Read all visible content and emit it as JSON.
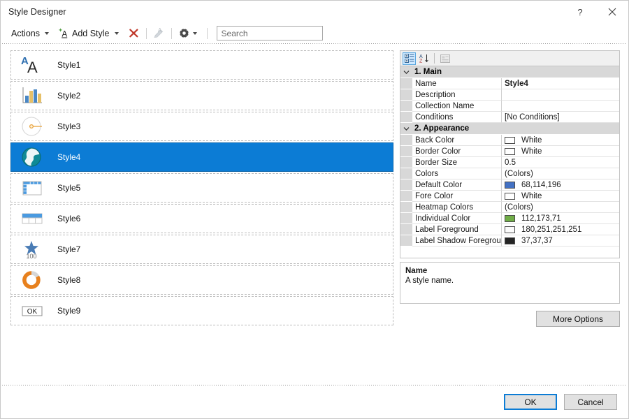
{
  "window": {
    "title": "Style Designer",
    "help_label": "?",
    "close_label": "Close"
  },
  "toolbar": {
    "actions_label": "Actions",
    "add_style_label": "Add Style",
    "delete_icon": "delete-style-icon",
    "edit_icon": "edit-style-icon",
    "settings_icon": "gear-icon",
    "search": {
      "placeholder": "Search",
      "value": ""
    }
  },
  "style_list": {
    "items": [
      {
        "label": "Style1",
        "icon": "text-style-icon",
        "selected": false
      },
      {
        "label": "Style2",
        "icon": "bar-chart-icon",
        "selected": false
      },
      {
        "label": "Style3",
        "icon": "gauge-icon",
        "selected": false
      },
      {
        "label": "Style4",
        "icon": "globe-map-icon",
        "selected": true
      },
      {
        "label": "Style5",
        "icon": "table-grid-icon",
        "selected": false
      },
      {
        "label": "Style6",
        "icon": "table-header-icon",
        "selected": false
      },
      {
        "label": "Style7",
        "icon": "kpi-star-icon",
        "selected": false,
        "badge": "100"
      },
      {
        "label": "Style8",
        "icon": "donut-chart-icon",
        "selected": false
      },
      {
        "label": "Style9",
        "icon": "button-ok-icon",
        "selected": false,
        "badge": "OK"
      }
    ]
  },
  "property_grid": {
    "toolbar": {
      "categorized_icon": "categorized-view-icon",
      "alphabetical_icon": "alphabetical-sort-icon",
      "property_pages_icon": "property-pages-icon"
    },
    "categories": [
      {
        "label": "1. Main",
        "expanded": true,
        "rows": [
          {
            "name": "Name",
            "value": "Style4",
            "bold": true
          },
          {
            "name": "Description",
            "value": ""
          },
          {
            "name": "Collection Name",
            "value": ""
          },
          {
            "name": "Conditions",
            "value": "[No Conditions]"
          }
        ]
      },
      {
        "label": "2. Appearance",
        "expanded": true,
        "rows": [
          {
            "name": "Back Color",
            "value": "White",
            "swatch": "#ffffff"
          },
          {
            "name": "Border Color",
            "value": "White",
            "swatch": "#ffffff"
          },
          {
            "name": "Border Size",
            "value": "0.5"
          },
          {
            "name": "Colors",
            "value": "(Colors)"
          },
          {
            "name": "Default Color",
            "value": "68,114,196",
            "swatch": "#4472c4"
          },
          {
            "name": "Fore Color",
            "value": "White",
            "swatch": "#ffffff"
          },
          {
            "name": "Heatmap Colors",
            "value": "(Colors)"
          },
          {
            "name": "Individual Color",
            "value": "112,173,71",
            "swatch": "#70ad47"
          },
          {
            "name": "Label Foreground",
            "value": "180,251,251,251",
            "swatch": "#fbfbfb"
          },
          {
            "name": "Label Shadow Foregroun",
            "value": "37,37,37",
            "swatch": "#252525"
          }
        ]
      }
    ],
    "description": {
      "title": "Name",
      "text": "A style name."
    },
    "more_options_label": "More Options"
  },
  "footer": {
    "ok_label": "OK",
    "cancel_label": "Cancel"
  },
  "colors": {
    "selection_blue": "#0c7cd5",
    "accent_blue": "#4472c4",
    "delete_red": "#c0392b",
    "add_green": "#4e9a3e",
    "orange": "#e8861e",
    "category_gray": "#d8d8d8"
  }
}
